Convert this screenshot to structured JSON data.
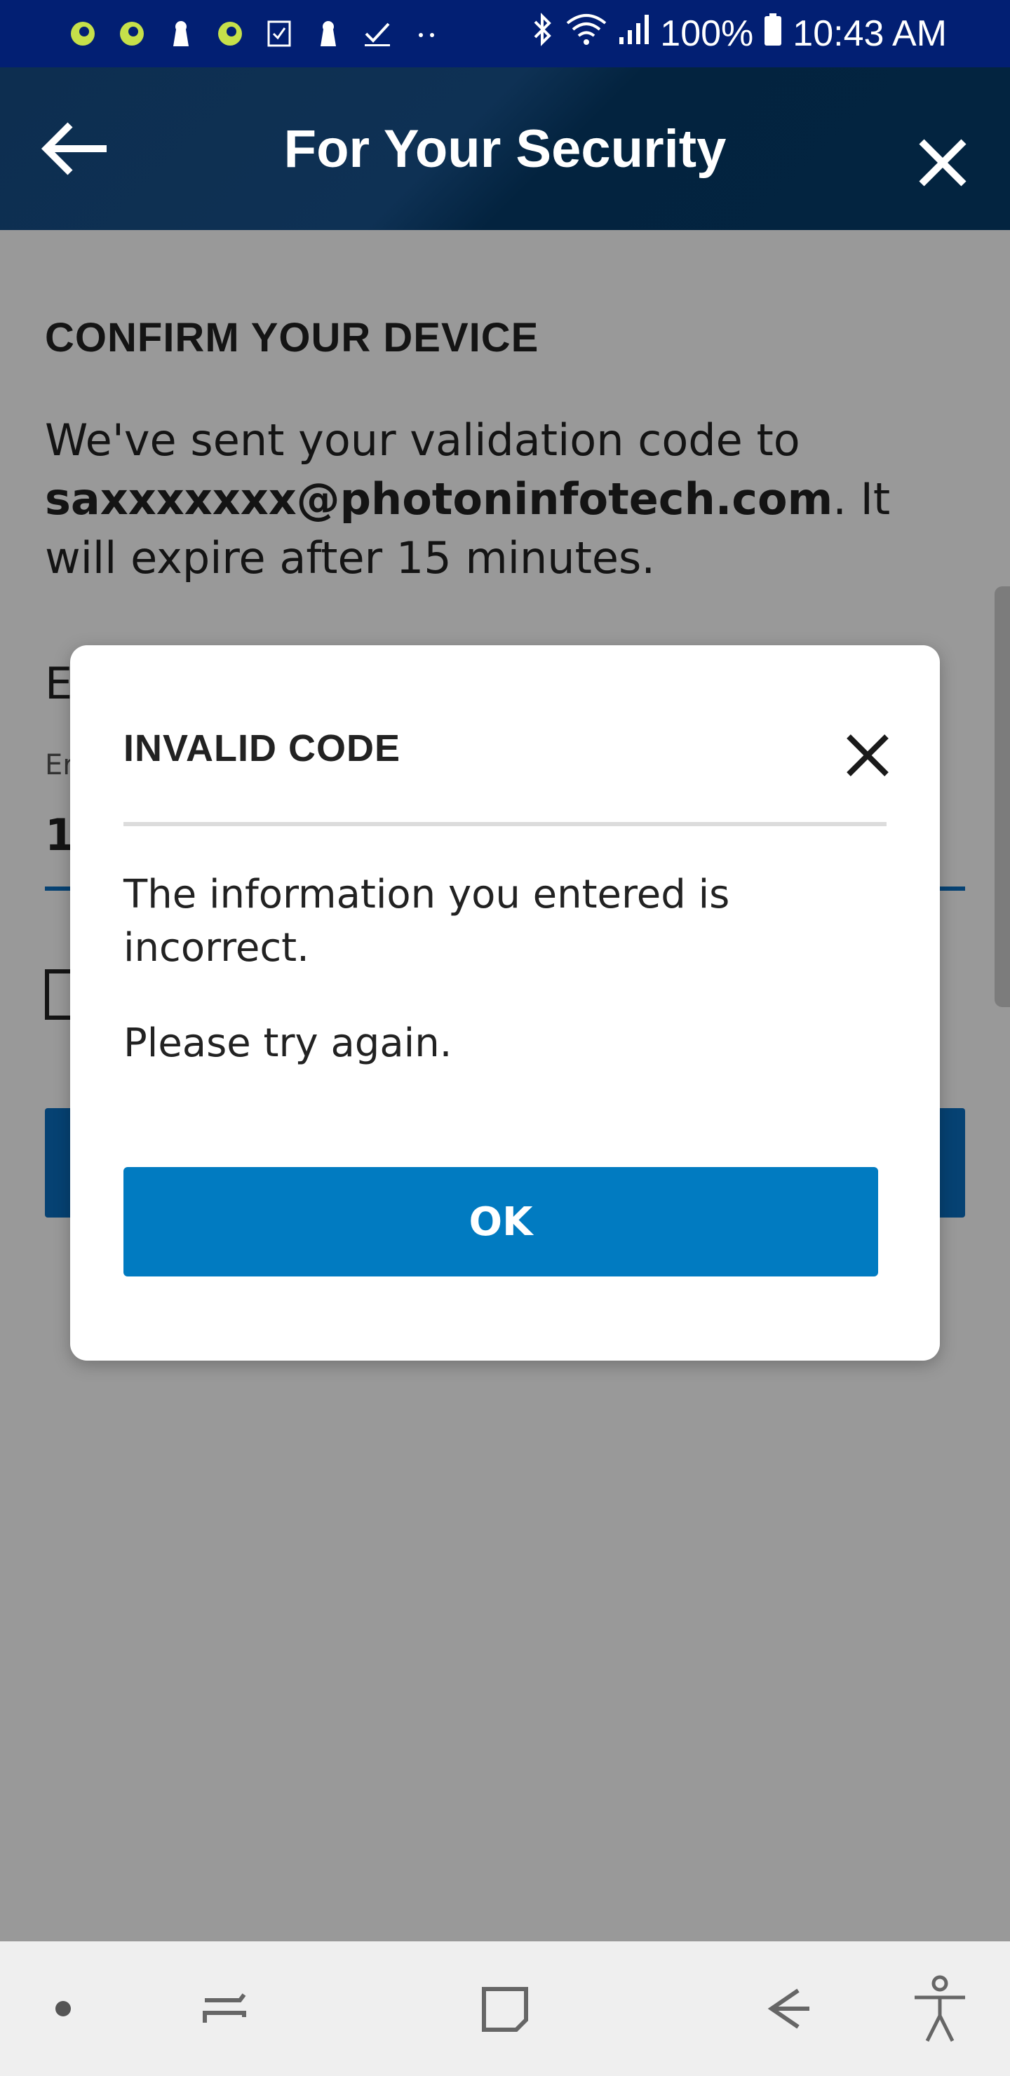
{
  "status_bar": {
    "notification_icons": [
      "app-icon",
      "app-icon",
      "keyhole-icon",
      "app-icon",
      "checklist-icon",
      "keyhole-icon",
      "check-icon",
      "more-dots-icon"
    ],
    "battery": "100%",
    "time": "10:43 AM",
    "system_icons": [
      "bluetooth-icon",
      "wifi-icon",
      "signal-icon",
      "battery-icon"
    ]
  },
  "app_bar": {
    "title": "For Your Security"
  },
  "page": {
    "heading": "CONFIRM YOUR DEVICE",
    "intro_prefix": "We've sent your validation code to ",
    "email": "saxxxxxxx@photoninfotech.com",
    "intro_suffix": ". It will expire after 15 minutes.",
    "field_heading_partial": "E",
    "field_label_partial": "Er",
    "field_value_partial": "1"
  },
  "dialog": {
    "title": "INVALID CODE",
    "message_line1": "The information you entered is incorrect.",
    "message_line2": "Please try again.",
    "ok_label": "OK"
  },
  "colors": {
    "status_bar": "#021f73",
    "app_bar": "#0d2e50",
    "primary_button": "#017bc1",
    "accent": "#0a6ec0"
  }
}
